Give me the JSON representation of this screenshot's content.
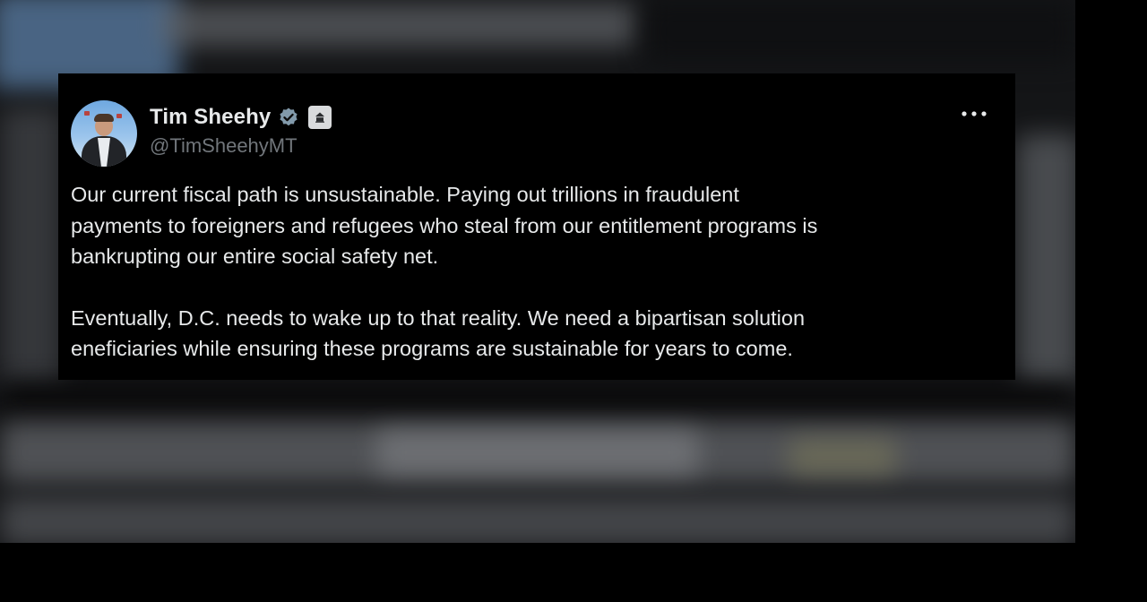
{
  "tweet": {
    "author": {
      "display_name": "Tim Sheehy",
      "handle": "@TimSheehyMT",
      "avatar": "avatar-photo",
      "verified_icon": "verified-badge-icon",
      "affiliate_icon": "government-affiliate-icon"
    },
    "more_icon": "more-options-icon",
    "paragraphs": [
      {
        "lines": [
          "Our current fiscal path is unsustainable. Paying out trillions in fraudulent",
          "payments to foreigners and refugees who steal from our entitlement programs is",
          "bankrupting our entire social safety net."
        ]
      },
      {
        "lines": [
          "Eventually, D.C. needs to wake up to that reality. We need a bipartisan solution",
          "eneficiaries while ensuring these programs are sustainable for years to come."
        ]
      }
    ]
  },
  "colors": {
    "text_primary": "#e7e9ea",
    "text_secondary": "#71767b",
    "verified": "#829aab",
    "background": "#000000"
  }
}
